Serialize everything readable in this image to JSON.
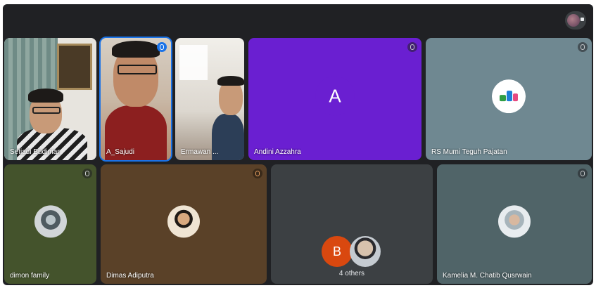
{
  "participants": [
    {
      "name": "Setiadi Budiman",
      "type": "video"
    },
    {
      "name": "A_Sajudi",
      "type": "video",
      "speaking": true
    },
    {
      "name": "Ermawan ...",
      "type": "video"
    },
    {
      "name": "Andini Azzahra",
      "type": "letter",
      "letter": "A",
      "bg": "#6a1fd1"
    },
    {
      "name": "RS Mumi Teguh Pajatan",
      "type": "logo",
      "bg": "#6f8891"
    },
    {
      "name": "dimon family",
      "type": "photo",
      "bg": "#44532c"
    },
    {
      "name": "Dimas Adiputra",
      "type": "photo",
      "bg": "#5a4128"
    },
    {
      "name": "Kamelia M. Chatib Qusrwain",
      "type": "photo",
      "bg": "#506468"
    }
  ],
  "others": {
    "letter": "B",
    "label": "4 others"
  },
  "colors": {
    "meeting_bg": "#202124",
    "speaking_blue": "#1a73e8",
    "others_orange": "#d9480f"
  }
}
